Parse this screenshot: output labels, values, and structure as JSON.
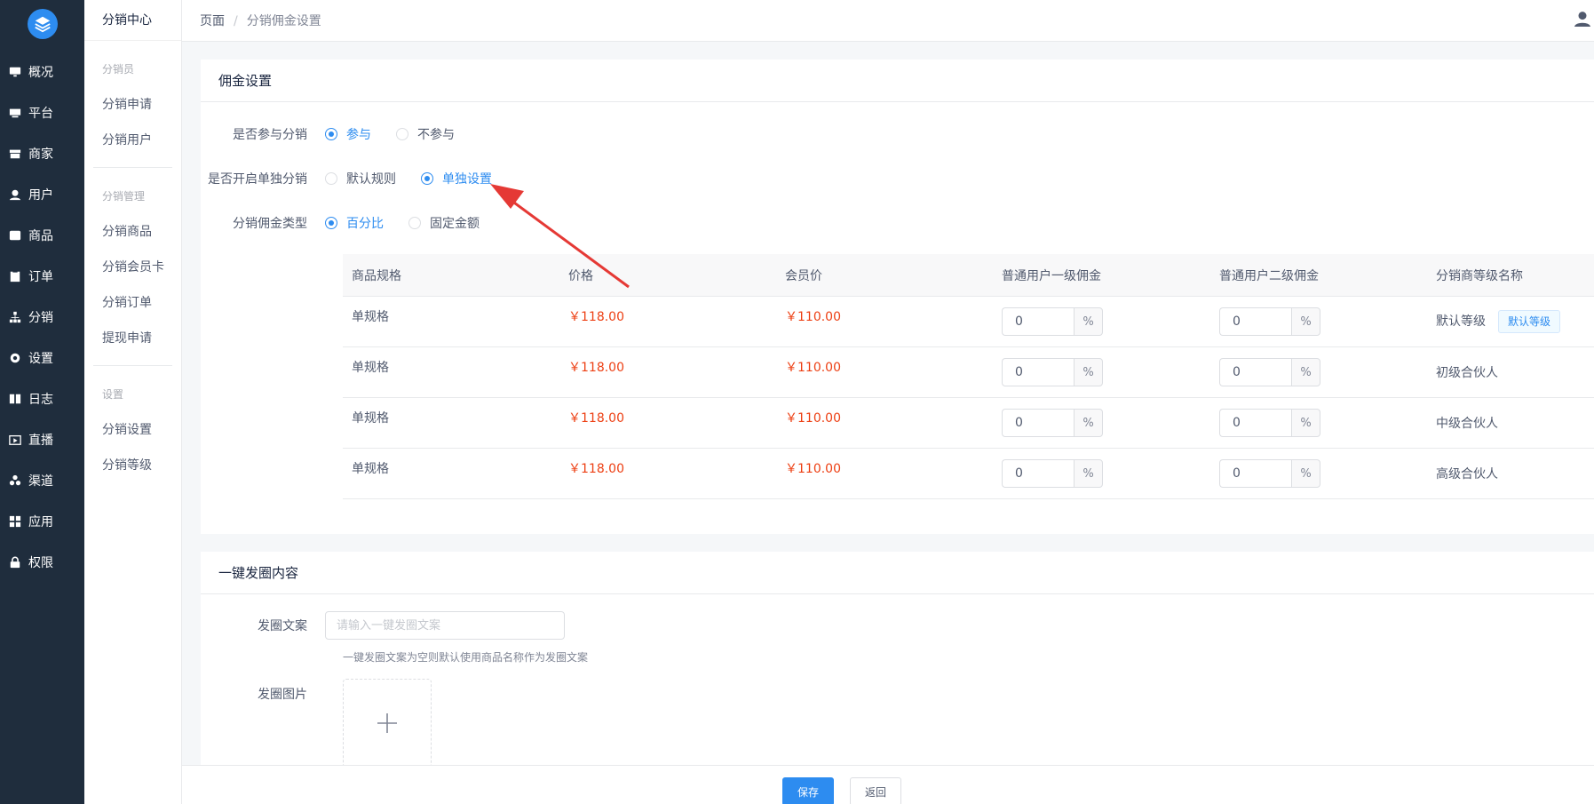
{
  "sidebar": {
    "items": [
      {
        "label": "概况",
        "icon": "monitor-icon"
      },
      {
        "label": "平台",
        "icon": "desktop-icon"
      },
      {
        "label": "商家",
        "icon": "store-icon"
      },
      {
        "label": "用户",
        "icon": "user-icon"
      },
      {
        "label": "商品",
        "icon": "goods-icon"
      },
      {
        "label": "订单",
        "icon": "clipboard-icon"
      },
      {
        "label": "分销",
        "icon": "sitemap-icon"
      },
      {
        "label": "设置",
        "icon": "gear-icon"
      },
      {
        "label": "日志",
        "icon": "book-icon"
      },
      {
        "label": "直播",
        "icon": "live-icon"
      },
      {
        "label": "渠道",
        "icon": "channel-icon"
      },
      {
        "label": "应用",
        "icon": "apps-icon"
      },
      {
        "label": "权限",
        "icon": "lock-icon"
      }
    ]
  },
  "subnav": {
    "title": "分销中心",
    "groups": [
      {
        "label": "分销员",
        "items": [
          "分销申请",
          "分销用户"
        ]
      },
      {
        "label": "分销管理",
        "items": [
          "分销商品",
          "分销会员卡",
          "分销订单",
          "提现申请"
        ]
      },
      {
        "label": "设置",
        "items": [
          "分销设置",
          "分销等级"
        ]
      }
    ]
  },
  "breadcrumb": {
    "root": "页面",
    "sep": "/",
    "current": "分销佣金设置"
  },
  "commission": {
    "title": "佣金设置",
    "join": {
      "label": "是否参与分销",
      "options": [
        "参与",
        "不参与"
      ]
    },
    "single": {
      "label": "是否开启单独分销",
      "options": [
        "默认规则",
        "单独设置"
      ]
    },
    "type": {
      "label": "分销佣金类型",
      "options": [
        "百分比",
        "固定金额"
      ]
    },
    "table": {
      "headers": [
        "商品规格",
        "价格",
        "会员价",
        "普通用户一级佣金",
        "普通用户二级佣金",
        "分销商等级名称"
      ],
      "unit": "%",
      "default_tag": "默认等级",
      "rows": [
        {
          "spec": "单规格",
          "price": "￥118.00",
          "member_price": "￥110.00",
          "level1": "0",
          "level2": "0",
          "grade": "默认等级"
        },
        {
          "spec": "单规格",
          "price": "￥118.00",
          "member_price": "￥110.00",
          "level1": "0",
          "level2": "0",
          "grade": "初级合伙人"
        },
        {
          "spec": "单规格",
          "price": "￥118.00",
          "member_price": "￥110.00",
          "level1": "0",
          "level2": "0",
          "grade": "中级合伙人"
        },
        {
          "spec": "单规格",
          "price": "￥118.00",
          "member_price": "￥110.00",
          "level1": "0",
          "level2": "0",
          "grade": "高级合伙人"
        }
      ]
    }
  },
  "moments": {
    "title": "一键发圈内容",
    "copy_label": "发圈文案",
    "copy_placeholder": "请输入一键发圈文案",
    "copy_hint": "一键发圈文案为空则默认使用商品名称作为发圈文案",
    "image_label": "发圈图片"
  },
  "footer": {
    "save": "保存",
    "back": "返回"
  },
  "colors": {
    "primary": "#2d8cf0",
    "price": "#ed4014",
    "sidebar": "#1f2d3d",
    "annotation_arrow": "#e53935"
  }
}
